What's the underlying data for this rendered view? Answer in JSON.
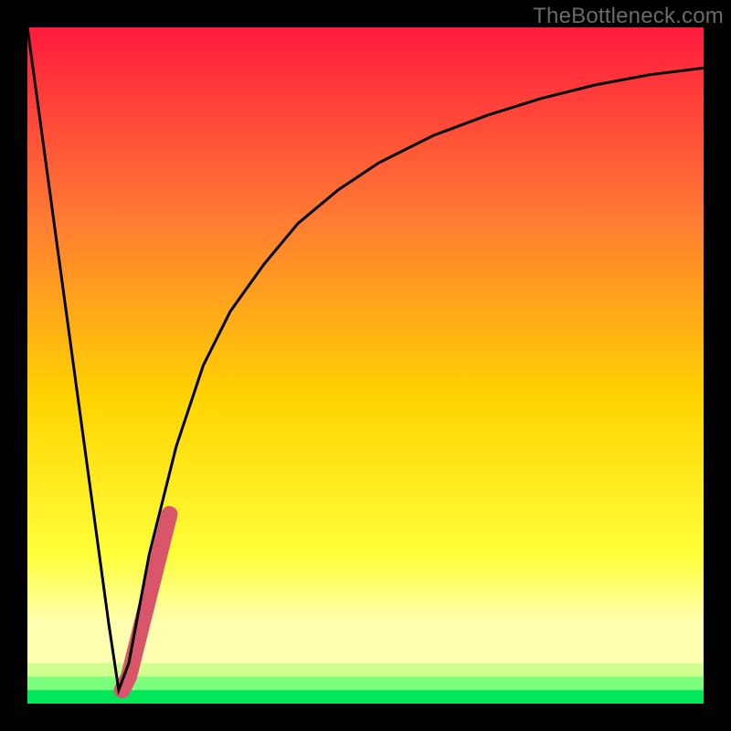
{
  "watermark": "TheBottleneck.com",
  "colors": {
    "frame": "#000000",
    "gradient_top": "#ff1a3d",
    "gradient_mid1": "#ff7a33",
    "gradient_mid2": "#ffd400",
    "gradient_mid3": "#ffff55",
    "gradient_band": "#ffffb0",
    "gradient_green": "#00e85a",
    "curve": "#000000",
    "marker": "#d9566a"
  },
  "chart_data": {
    "type": "line",
    "title": "",
    "xlabel": "",
    "ylabel": "",
    "xlim": [
      0,
      100
    ],
    "ylim": [
      0,
      100
    ],
    "series": [
      {
        "name": "bottleneck-curve",
        "x": [
          0,
          3,
          6,
          9,
          12,
          13.5,
          15,
          18,
          22,
          26,
          30,
          35,
          40,
          46,
          52,
          60,
          68,
          76,
          84,
          92,
          100
        ],
        "y": [
          100,
          78,
          56,
          34,
          12,
          2,
          6,
          22,
          38,
          50,
          58,
          65,
          71,
          76,
          80,
          84,
          87,
          89.5,
          91.5,
          93,
          94
        ]
      }
    ],
    "annotations": [
      {
        "name": "highlight-segment",
        "x": [
          14,
          15,
          16,
          17,
          18,
          19,
          20,
          21
        ],
        "y": [
          2,
          4,
          8,
          12,
          16,
          20,
          24,
          28
        ],
        "stroke_width": 18,
        "color": "#d9566a"
      }
    ],
    "background_bands": [
      {
        "y0": 0,
        "y1": 2,
        "color": "#00e85a"
      },
      {
        "y0": 2,
        "y1": 4,
        "color": "#7dff7d"
      },
      {
        "y0": 4,
        "y1": 6,
        "color": "#d0ff90"
      },
      {
        "y0": 6,
        "y1": 12,
        "color": "#ffffb0"
      }
    ]
  }
}
